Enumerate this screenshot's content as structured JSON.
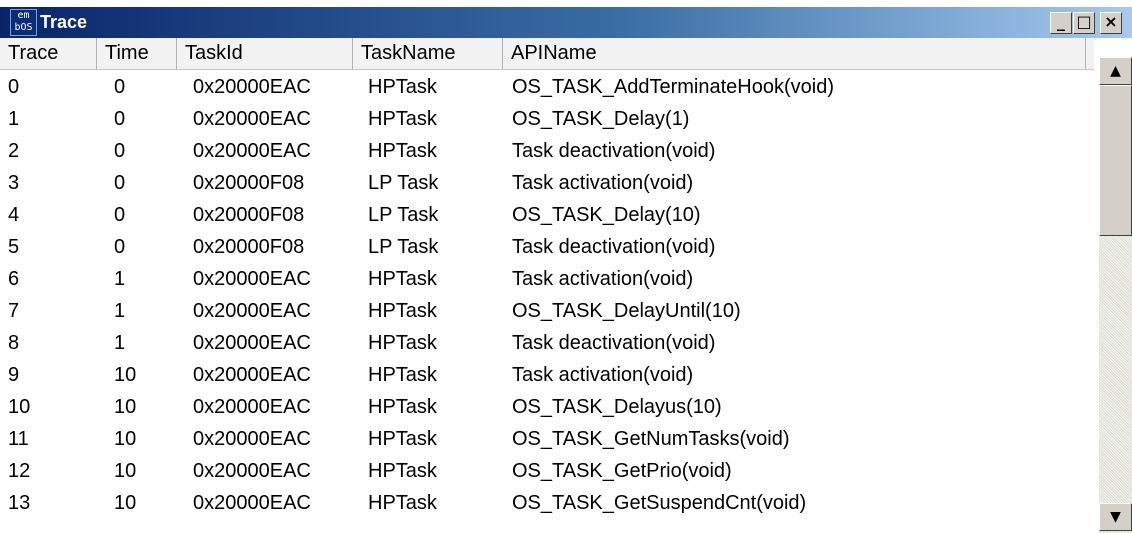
{
  "window": {
    "title": "Trace",
    "icon_text_top": "em",
    "icon_text_bottom": "bOS",
    "buttons": {
      "minimize": "_",
      "maximize": "□",
      "close": "×"
    }
  },
  "colors": {
    "titlebar_start": "#0a246a",
    "titlebar_end": "#a6caf0",
    "header_bg": "#f2f2f2",
    "scrollbar_track": "#ece9e4"
  },
  "table": {
    "columns": [
      "Trace",
      "Time",
      "TaskId",
      "TaskName",
      "APIName"
    ],
    "rows": [
      {
        "trace": "0",
        "time": "0",
        "taskid": "0x20000EAC",
        "taskname": "HPTask",
        "apiname": "OS_TASK_AddTerminateHook(void)"
      },
      {
        "trace": "1",
        "time": "0",
        "taskid": "0x20000EAC",
        "taskname": "HPTask",
        "apiname": "OS_TASK_Delay(1)"
      },
      {
        "trace": "2",
        "time": "0",
        "taskid": "0x20000EAC",
        "taskname": "HPTask",
        "apiname": "Task deactivation(void)"
      },
      {
        "trace": "3",
        "time": "0",
        "taskid": "0x20000F08",
        "taskname": "LP Task",
        "apiname": "Task activation(void)"
      },
      {
        "trace": "4",
        "time": "0",
        "taskid": "0x20000F08",
        "taskname": "LP Task",
        "apiname": "OS_TASK_Delay(10)"
      },
      {
        "trace": "5",
        "time": "0",
        "taskid": "0x20000F08",
        "taskname": "LP Task",
        "apiname": "Task deactivation(void)"
      },
      {
        "trace": "6",
        "time": "1",
        "taskid": "0x20000EAC",
        "taskname": "HPTask",
        "apiname": "Task activation(void)"
      },
      {
        "trace": "7",
        "time": "1",
        "taskid": "0x20000EAC",
        "taskname": "HPTask",
        "apiname": "OS_TASK_DelayUntil(10)"
      },
      {
        "trace": "8",
        "time": "1",
        "taskid": "0x20000EAC",
        "taskname": "HPTask",
        "apiname": "Task deactivation(void)"
      },
      {
        "trace": "9",
        "time": "10",
        "taskid": "0x20000EAC",
        "taskname": "HPTask",
        "apiname": "Task activation(void)"
      },
      {
        "trace": "10",
        "time": "10",
        "taskid": "0x20000EAC",
        "taskname": "HPTask",
        "apiname": "OS_TASK_Delayus(10)"
      },
      {
        "trace": "11",
        "time": "10",
        "taskid": "0x20000EAC",
        "taskname": "HPTask",
        "apiname": "OS_TASK_GetNumTasks(void)"
      },
      {
        "trace": "12",
        "time": "10",
        "taskid": "0x20000EAC",
        "taskname": "HPTask",
        "apiname": "OS_TASK_GetPrio(void)"
      },
      {
        "trace": "13",
        "time": "10",
        "taskid": "0x20000EAC",
        "taskname": "HPTask",
        "apiname": "OS_TASK_GetSuspendCnt(void)"
      }
    ]
  },
  "scrollbar": {
    "up_icon": "scroll-up-arrow-icon",
    "down_icon": "scroll-down-arrow-icon",
    "up_glyph": "▲",
    "down_glyph": "▼"
  }
}
